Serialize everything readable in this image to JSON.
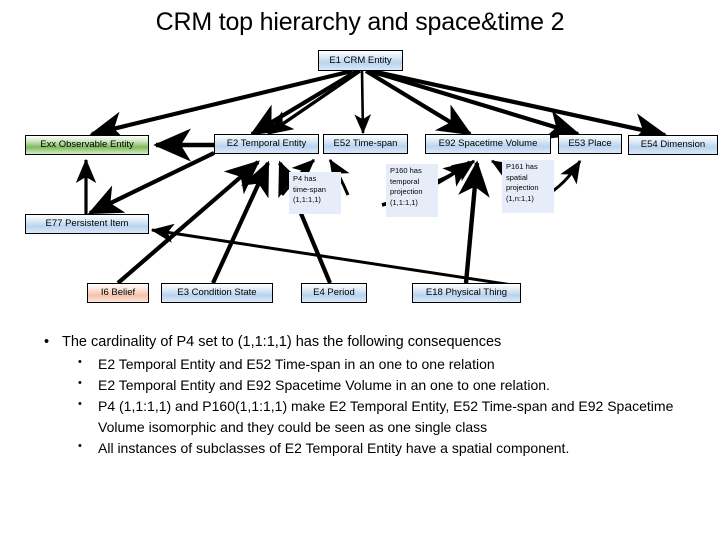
{
  "slide": {
    "title": "CRM top hierarchy and space&time  2"
  },
  "nodes": {
    "e1": {
      "label": "E1 CRM Entity"
    },
    "exx": {
      "label": "Exx Observable Entity"
    },
    "e2": {
      "label": "E2 Temporal Entity"
    },
    "e52": {
      "label": "E52 Time-span"
    },
    "e92": {
      "label": "E92 Spacetime Volume"
    },
    "e53": {
      "label": "E53 Place"
    },
    "e54": {
      "label": "E54 Dimension"
    },
    "e77": {
      "label": "E77 Persistent Item"
    },
    "i6": {
      "label": "I6 Belief"
    },
    "e3": {
      "label": "E3 Condition State"
    },
    "e4": {
      "label": "E4 Period"
    },
    "e18": {
      "label": "E18 Physical Thing"
    }
  },
  "properties": {
    "p4": {
      "line1": "P4 has",
      "line2": "time-span",
      "line3": "(1,1:1,1)"
    },
    "p160": {
      "line1": "P160 has",
      "line2": "temporal",
      "line3": "projection",
      "line4": "(1,1:1,1)"
    },
    "p161": {
      "line1": "P161 has",
      "line2": "spatial",
      "line3": "projection",
      "line4": "(1,n:1,1)"
    }
  },
  "bullets": {
    "lead": "The cardinality of P4 set to (1,1:1,1) has the following consequences",
    "sub": [
      "E2 Temporal Entity and E52 Time-span in an one to one relation",
      "E2 Temporal Entity and E92 Spacetime Volume  in an one to one relation.",
      "P4 (1,1:1,1) and P160(1,1:1,1) make E2 Temporal Entity, E52 Time-span and E92 Spacetime Volume isomorphic and they could be seen as one single class",
      "All instances of subclasses of E2 Temporal Entity have a spatial component."
    ],
    "marker_level1": "•",
    "marker_level2": "•"
  },
  "colors": {
    "box_blue": "#b9d4ee",
    "box_green": "#7fba5e",
    "box_salmon": "#f4c3ad",
    "prop_bg": "#e7edf8",
    "edge": "#000000",
    "text": "#000000"
  }
}
